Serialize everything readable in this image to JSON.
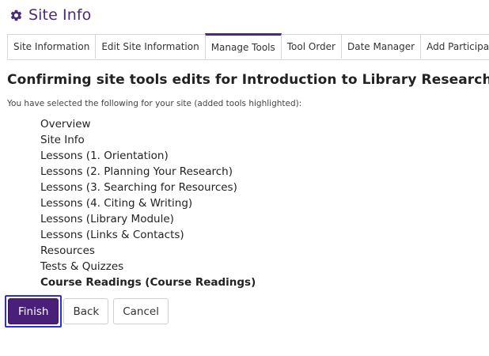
{
  "header": {
    "title": "Site Info",
    "icon": "gear-icon"
  },
  "tabs": [
    {
      "label": "Site Information",
      "active": false
    },
    {
      "label": "Edit Site Information",
      "active": false
    },
    {
      "label": "Manage Tools",
      "active": true
    },
    {
      "label": "Tool Order",
      "active": false
    },
    {
      "label": "Date Manager",
      "active": false
    },
    {
      "label": "Add Participants",
      "active": false
    }
  ],
  "main": {
    "heading": "Confirming site tools edits for Introduction to Library Research",
    "intro": "You have selected the following for your site (added tools highlighted):",
    "tools": [
      {
        "label": "Overview",
        "added": false
      },
      {
        "label": "Site Info",
        "added": false
      },
      {
        "label": "Lessons (1. Orientation)",
        "added": false
      },
      {
        "label": "Lessons (2. Planning Your Research)",
        "added": false
      },
      {
        "label": "Lessons (3. Searching for Resources)",
        "added": false
      },
      {
        "label": "Lessons (4. Citing & Writing)",
        "added": false
      },
      {
        "label": "Lessons (Library Module)",
        "added": false
      },
      {
        "label": "Lessons (Links & Contacts)",
        "added": false
      },
      {
        "label": "Resources",
        "added": false
      },
      {
        "label": "Tests & Quizzes",
        "added": false
      },
      {
        "label": "Course Readings (Course Readings)",
        "added": true
      }
    ]
  },
  "actions": {
    "finish_label": "Finish",
    "back_label": "Back",
    "cancel_label": "Cancel"
  },
  "colors": {
    "brand": "#4a2a7c",
    "primary_button": "#4a1f7a",
    "focus_ring": "#2b2fd9"
  }
}
